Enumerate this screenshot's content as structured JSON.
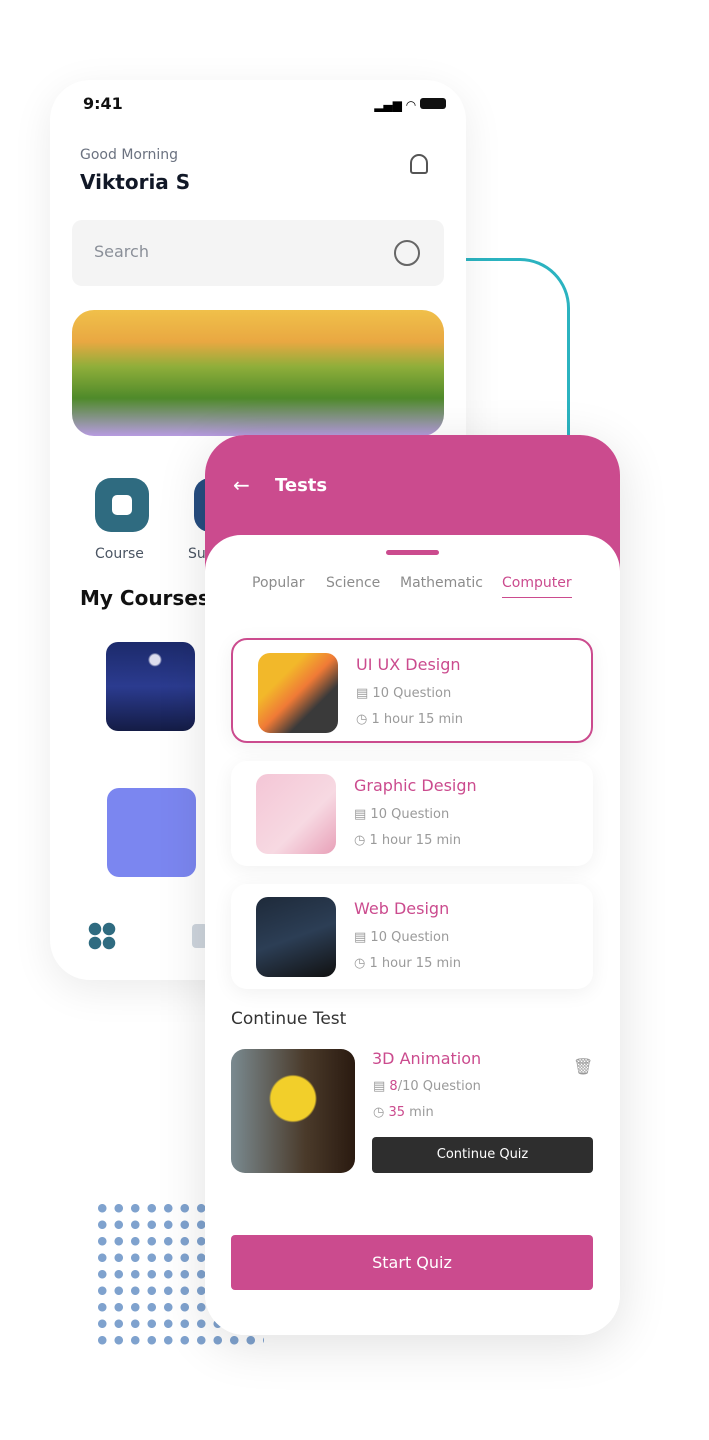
{
  "home": {
    "time": "9:41",
    "greeting": "Good Morning",
    "user_name": "Viktoria S",
    "search_placeholder": "Search",
    "categories": [
      {
        "label": "Course",
        "icon": "book-icon"
      },
      {
        "label": "Su",
        "icon": "category-icon"
      }
    ],
    "section_title": "My Courses"
  },
  "tests": {
    "title": "Tests",
    "tabs": [
      "Popular",
      "Science",
      "Mathematic",
      "Computer"
    ],
    "active_tab": "Computer",
    "items": [
      {
        "title": "UI UX Design",
        "questions": "10 Question",
        "duration": "1 hour 15 min",
        "selected": true
      },
      {
        "title": "Graphic Design",
        "questions": "10 Question",
        "duration": "1 hour 15 min"
      },
      {
        "title": "Web Design",
        "questions": "10 Question",
        "duration": "1 hour 15 min"
      }
    ],
    "continue_title": "Continue Test",
    "continue_item": {
      "title": "3D Animation",
      "answered": "8",
      "questions_rest": "/10 Question",
      "time_value": "35",
      "time_unit": " min",
      "button": "Continue Quiz"
    },
    "start_button": "Start Quiz"
  },
  "colors": {
    "accent": "#CB4B8E",
    "teal": "#2F6B80",
    "dark": "#2E2E2E"
  }
}
